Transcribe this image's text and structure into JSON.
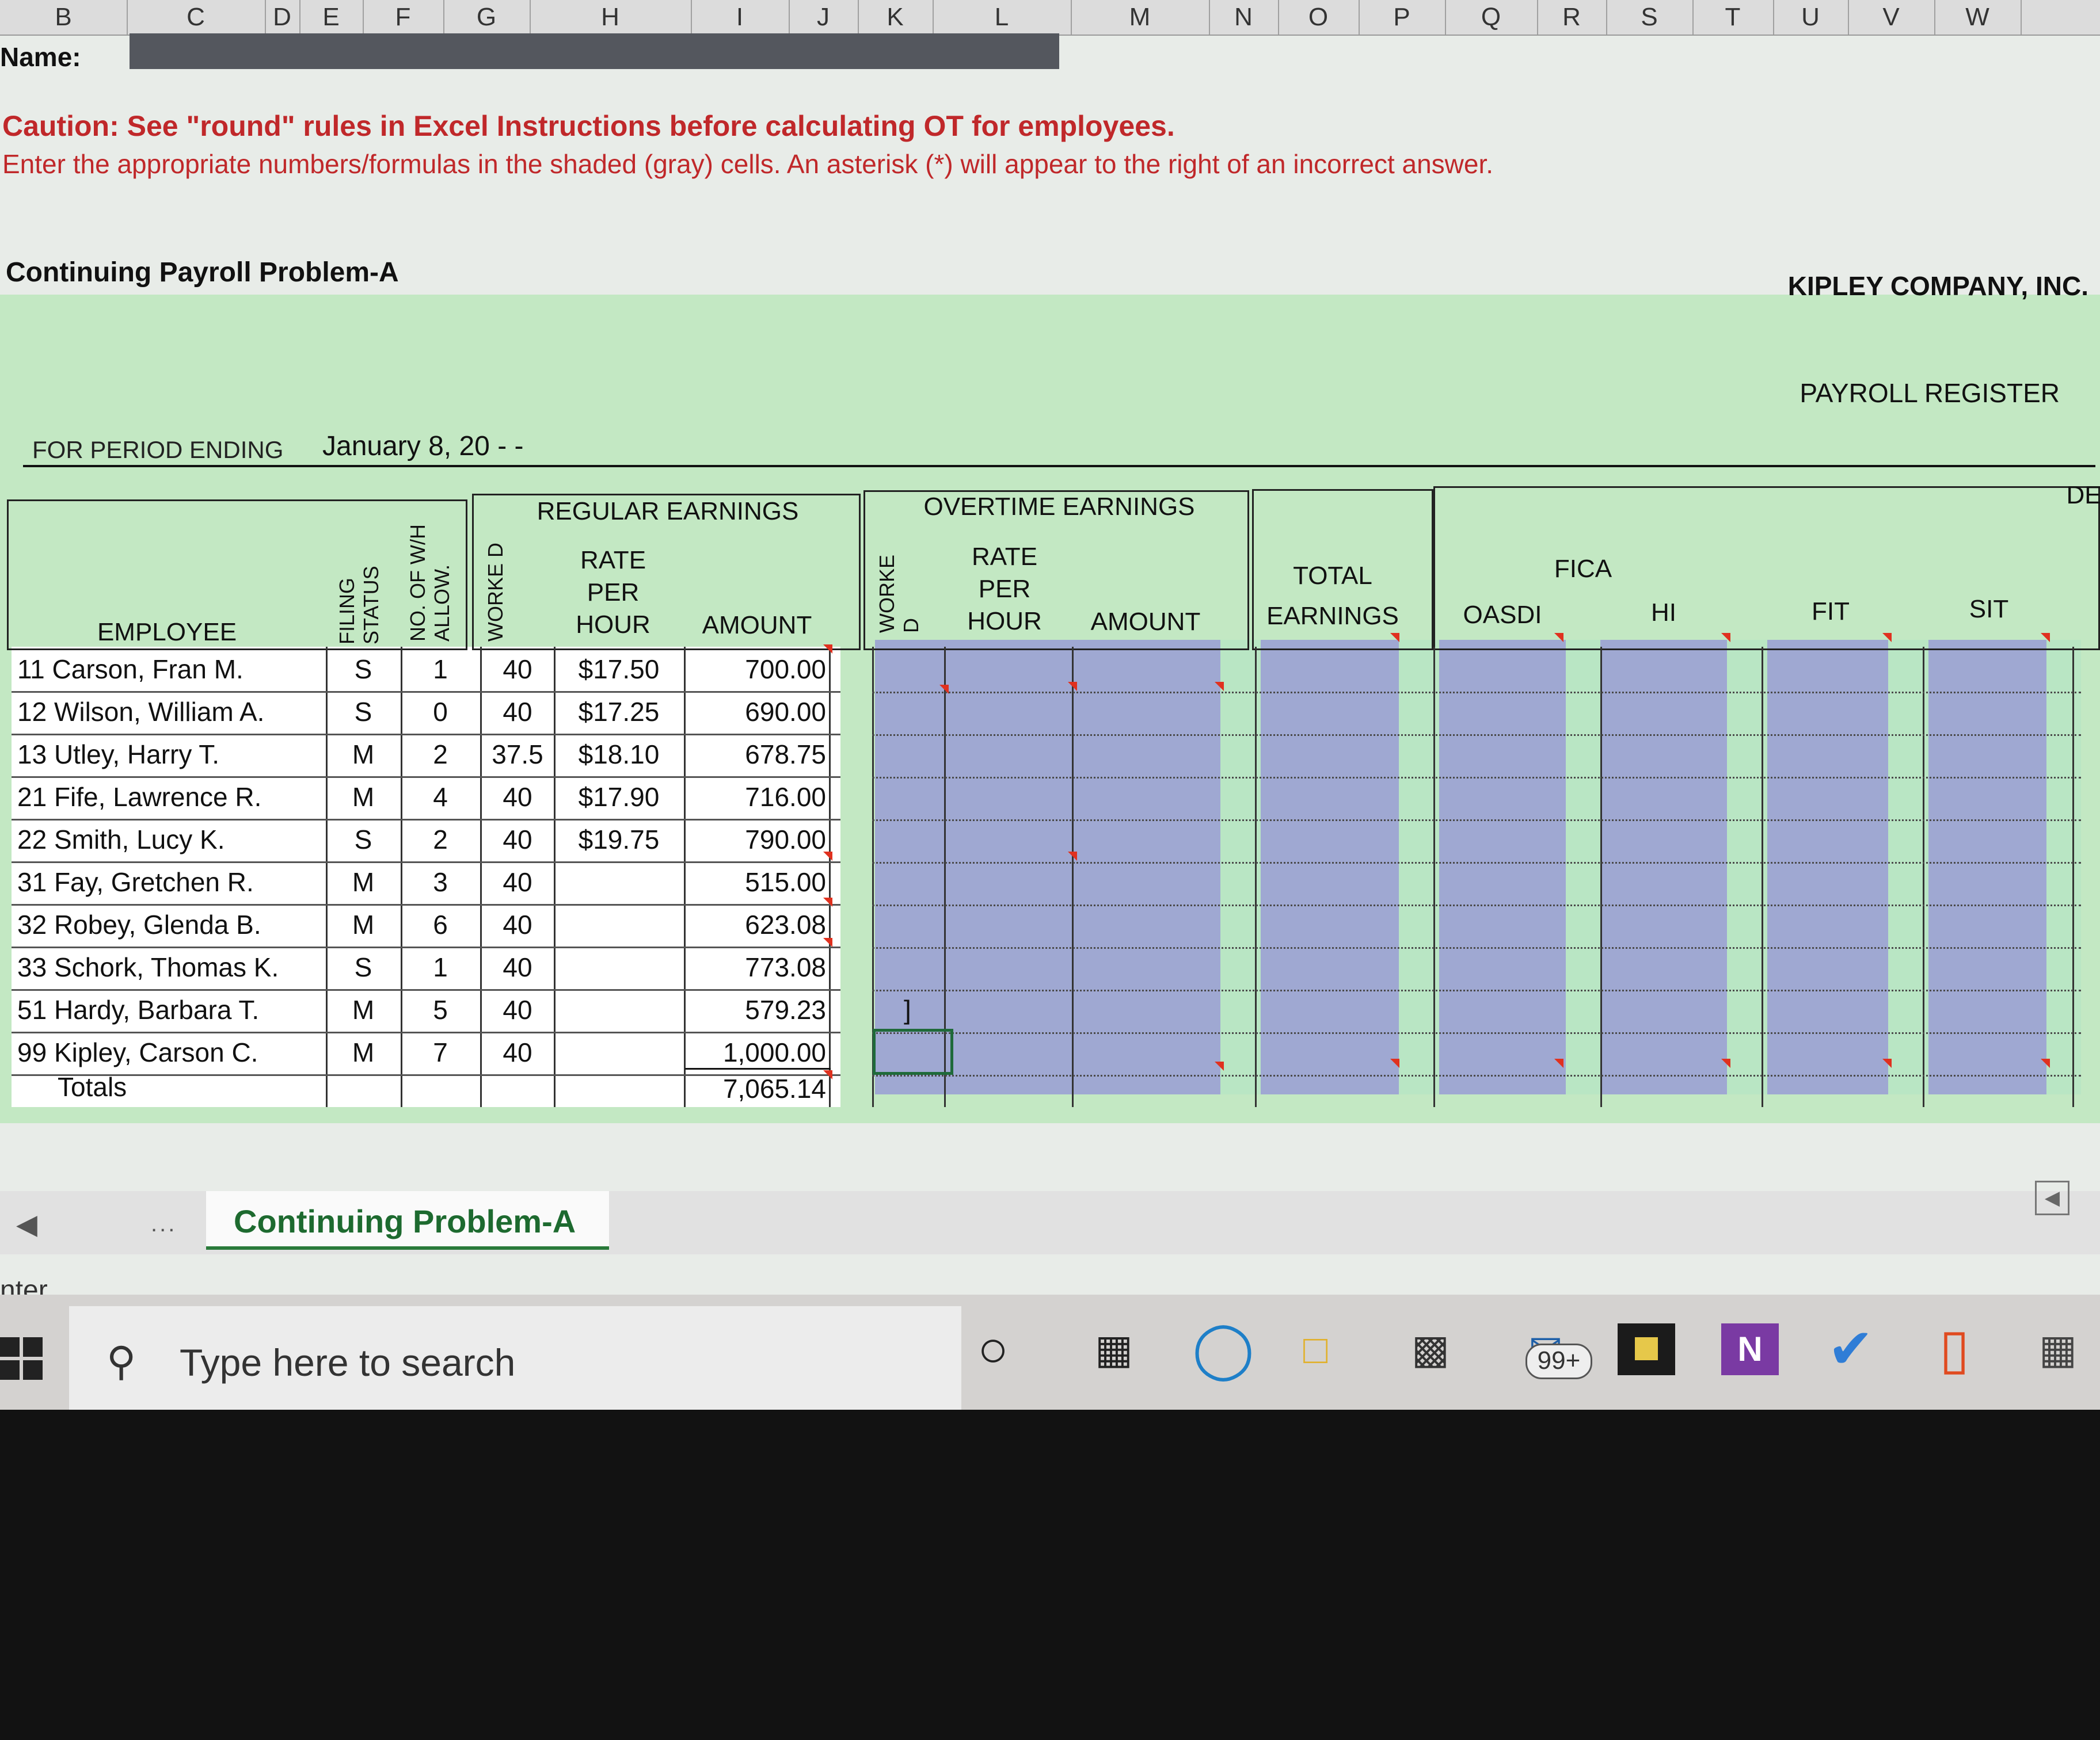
{
  "column_headers": [
    "B",
    "C",
    "D",
    "E",
    "F",
    "G",
    "H",
    "I",
    "J",
    "K",
    "L",
    "M",
    "N",
    "O",
    "P",
    "Q",
    "R",
    "S",
    "T",
    "U",
    "V",
    "W"
  ],
  "name_label": "Name:",
  "caution": "Caution: See \"round\" rules in Excel Instructions before calculating OT for employees.",
  "instructions": "Enter the appropriate numbers/formulas in the shaded (gray) cells. An asterisk (*) will appear to the right of an incorrect answer.",
  "sheet_title": "Continuing Payroll Problem-A",
  "company": "KIPLEY COMPANY, INC.",
  "register_title": "PAYROLL REGISTER",
  "period_label": "FOR PERIOD ENDING",
  "period_value": "January 8, 20 - -",
  "headers": {
    "employee": "EMPLOYEE",
    "filing_status": "FILING STATUS",
    "allowances": "NO. OF W/H ALLOW.",
    "worked": "WORKE D",
    "regular": "REGULAR EARNINGS",
    "rate_per_hour": "RATE PER HOUR",
    "amount": "AMOUNT",
    "overtime": "OVERTIME EARNINGS",
    "ot_worked": "WORKE D",
    "ot_rate": "RATE PER HOUR",
    "ot_amount": "AMOUNT",
    "total_earnings": "TOTAL EARNINGS",
    "fica": "FICA",
    "oasdi": "OASDI",
    "hi": "HI",
    "fit": "FIT",
    "sit": "SIT",
    "ded": "DE"
  },
  "employees": [
    {
      "name": "11 Carson, Fran M.",
      "status": "S",
      "allow": "1",
      "hours": "40",
      "rate": "$17.50",
      "amount": "700.00"
    },
    {
      "name": "12 Wilson, William A.",
      "status": "S",
      "allow": "0",
      "hours": "40",
      "rate": "$17.25",
      "amount": "690.00"
    },
    {
      "name": "13 Utley, Harry T.",
      "status": "M",
      "allow": "2",
      "hours": "37.5",
      "rate": "$18.10",
      "amount": "678.75"
    },
    {
      "name": "21 Fife, Lawrence R.",
      "status": "M",
      "allow": "4",
      "hours": "40",
      "rate": "$17.90",
      "amount": "716.00"
    },
    {
      "name": "22 Smith, Lucy K.",
      "status": "S",
      "allow": "2",
      "hours": "40",
      "rate": "$19.75",
      "amount": "790.00"
    },
    {
      "name": "31 Fay, Gretchen R.",
      "status": "M",
      "allow": "3",
      "hours": "40",
      "rate": "",
      "amount": "515.00"
    },
    {
      "name": "32 Robey, Glenda B.",
      "status": "M",
      "allow": "6",
      "hours": "40",
      "rate": "",
      "amount": "623.08"
    },
    {
      "name": "33 Schork, Thomas K.",
      "status": "S",
      "allow": "1",
      "hours": "40",
      "rate": "",
      "amount": "773.08"
    },
    {
      "name": "51 Hardy, Barbara T.",
      "status": "M",
      "allow": "5",
      "hours": "40",
      "rate": "",
      "amount": "579.23"
    },
    {
      "name": "99 Kipley, Carson C.",
      "status": "M",
      "allow": "7",
      "hours": "40",
      "rate": "",
      "amount": "1,000.00"
    }
  ],
  "totals_label": "Totals",
  "totals_amount": "7,065.14",
  "ot_cursor_mark": "]",
  "sheet_tab": "Continuing Problem-A",
  "tab_more": "...",
  "status_text": "nter",
  "taskbar": {
    "search_placeholder": "Type here to search",
    "mail_badge": "99+",
    "onenote_letter": "N"
  },
  "colors": {
    "register_green": "#c3e8c3",
    "shaded_input": "#9fa8d2",
    "caution_red": "#c0282a",
    "error_marker": "#e0311f"
  }
}
